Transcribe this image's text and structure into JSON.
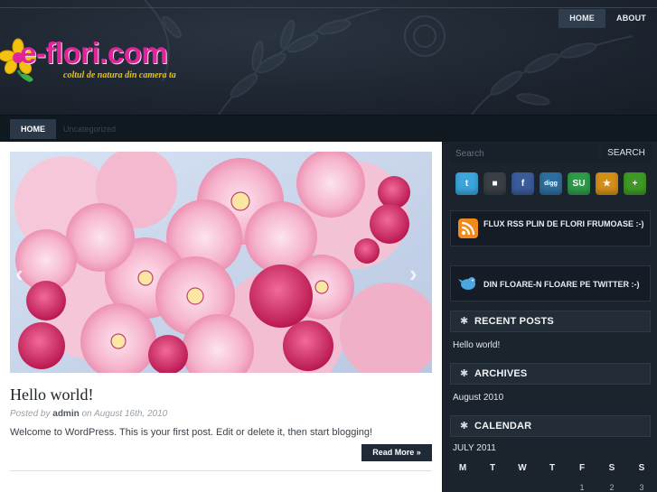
{
  "header": {
    "top_nav": [
      {
        "label": "HOME",
        "active": true
      },
      {
        "label": "ABOUT",
        "active": false
      }
    ],
    "logo_text": "e-flori.com",
    "tagline": "coltul de natura din camera ta"
  },
  "nav_bar": {
    "home_label": "HOME",
    "category_label": "Uncategorized"
  },
  "post": {
    "title": "Hello world!",
    "meta_prefix": "Posted by",
    "author": "admin",
    "meta_on": "on",
    "date": "August 16th, 2010",
    "excerpt": "Welcome to WordPress. This is your first post. Edit or delete it, then start blogging!",
    "read_more": "Read More »"
  },
  "sidebar": {
    "search_placeholder": "Search",
    "search_button": "SEARCH",
    "social_icons": [
      {
        "name": "twitter-icon",
        "color": "#3ba5dc",
        "glyph": "t"
      },
      {
        "name": "delicious-icon",
        "color": "#3a3f46",
        "glyph": "■"
      },
      {
        "name": "facebook-icon",
        "color": "#3b5b9a",
        "glyph": "f"
      },
      {
        "name": "digg-icon",
        "color": "#2e6e9e",
        "glyph": "digg"
      },
      {
        "name": "stumbleupon-icon",
        "color": "#2f9a48",
        "glyph": "SU"
      },
      {
        "name": "favorite-star-icon",
        "color": "#d48f1a",
        "glyph": "★"
      },
      {
        "name": "add-plus-icon",
        "color": "#3f9a25",
        "glyph": "+"
      }
    ],
    "rss_feature": "FLUX RSS PLIN DE FLORI FRUMOASE :-)",
    "twitter_feature": "DIN FLOARE-N FLOARE PE TWITTER :-)",
    "recent_posts": {
      "title": "RECENT POSTS",
      "items": [
        "Hello world!"
      ]
    },
    "archives": {
      "title": "ARCHIVES",
      "items": [
        "August 2010"
      ]
    },
    "calendar": {
      "title": "CALENDAR",
      "month": "JULY 2011",
      "days": [
        "M",
        "T",
        "W",
        "T",
        "F",
        "S",
        "S"
      ],
      "first_row": [
        "",
        "",
        "",
        "",
        "1",
        "2",
        "3"
      ]
    }
  },
  "colors": {
    "logo_pink": "#e0249a",
    "tagline_yellow": "#e8c20c",
    "header_bg": "#1e2631",
    "sidebar_bg": "#1b232d"
  }
}
